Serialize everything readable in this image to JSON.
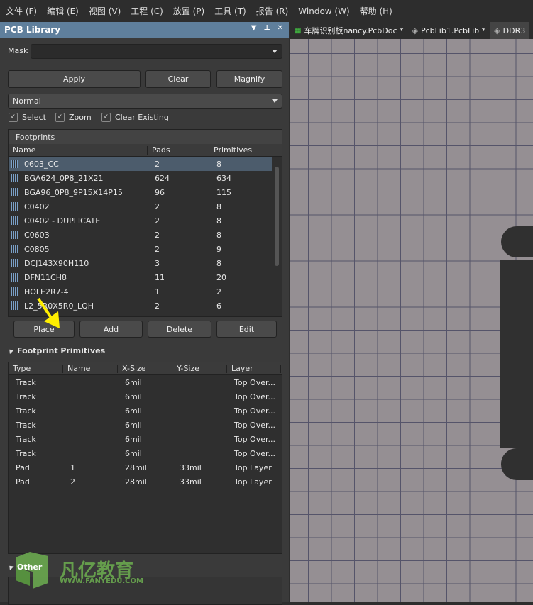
{
  "menu": [
    "文件 (F)",
    "编辑 (E)",
    "视图 (V)",
    "工程 (C)",
    "放置 (P)",
    "工具 (T)",
    "报告 (R)",
    "Window (W)",
    "帮助 (H)"
  ],
  "panel": {
    "title": "PCB Library",
    "mask_label": "Mask",
    "mask_value": "",
    "apply": "Apply",
    "clear": "Clear",
    "magnify": "Magnify",
    "mode": "Normal",
    "checks": [
      {
        "label": "Select",
        "checked": true
      },
      {
        "label": "Zoom",
        "checked": true
      },
      {
        "label": "Clear Existing",
        "checked": true
      }
    ]
  },
  "footprints": {
    "title": "Footprints",
    "columns": [
      "Name",
      "Pads",
      "Primitives"
    ],
    "rows": [
      [
        "0603_CC",
        "2",
        "8"
      ],
      [
        "BGA624_0P8_21X21",
        "624",
        "634"
      ],
      [
        "BGA96_0P8_9P15X14P15",
        "96",
        "115"
      ],
      [
        "C0402",
        "2",
        "8"
      ],
      [
        "C0402 - DUPLICATE",
        "2",
        "8"
      ],
      [
        "C0603",
        "2",
        "8"
      ],
      [
        "C0805",
        "2",
        "9"
      ],
      [
        "DCJ143X90H110",
        "3",
        "8"
      ],
      [
        "DFN11CH8",
        "11",
        "20"
      ],
      [
        "HOLE2R7-4",
        "1",
        "2"
      ],
      [
        "L2_5R0X5R0_LQH",
        "2",
        "6"
      ]
    ],
    "selected": 0,
    "place": "Place",
    "add": "Add",
    "delete": "Delete",
    "edit": "Edit"
  },
  "primitives": {
    "title": "Footprint Primitives",
    "columns": [
      "Type",
      "Name",
      "X-Size",
      "Y-Size",
      "Layer"
    ],
    "rows": [
      [
        "Track",
        "",
        "6mil",
        "",
        "Top Over..."
      ],
      [
        "Track",
        "",
        "6mil",
        "",
        "Top Over..."
      ],
      [
        "Track",
        "",
        "6mil",
        "",
        "Top Over..."
      ],
      [
        "Track",
        "",
        "6mil",
        "",
        "Top Over..."
      ],
      [
        "Track",
        "",
        "6mil",
        "",
        "Top Over..."
      ],
      [
        "Track",
        "",
        "6mil",
        "",
        "Top Over..."
      ],
      [
        "Pad",
        "1",
        "28mil",
        "33mil",
        "Top Layer"
      ],
      [
        "Pad",
        "2",
        "28mil",
        "33mil",
        "Top Layer"
      ]
    ]
  },
  "other": {
    "title": "Other"
  },
  "tabs": [
    {
      "label": "车牌识别板nancy.PcbDoc *"
    },
    {
      "label": "PcbLib1.PcbLib *"
    },
    {
      "label": "DDR3"
    }
  ],
  "watermark": {
    "name": "凡亿教育",
    "url": "WWW.FANYEDU.COM",
    "color": "#6aa84f"
  },
  "colors": {
    "titlebar": "#5f7f9c",
    "canvas": "#958f93",
    "grid": "#55546a",
    "arrow": "#ffee00"
  }
}
